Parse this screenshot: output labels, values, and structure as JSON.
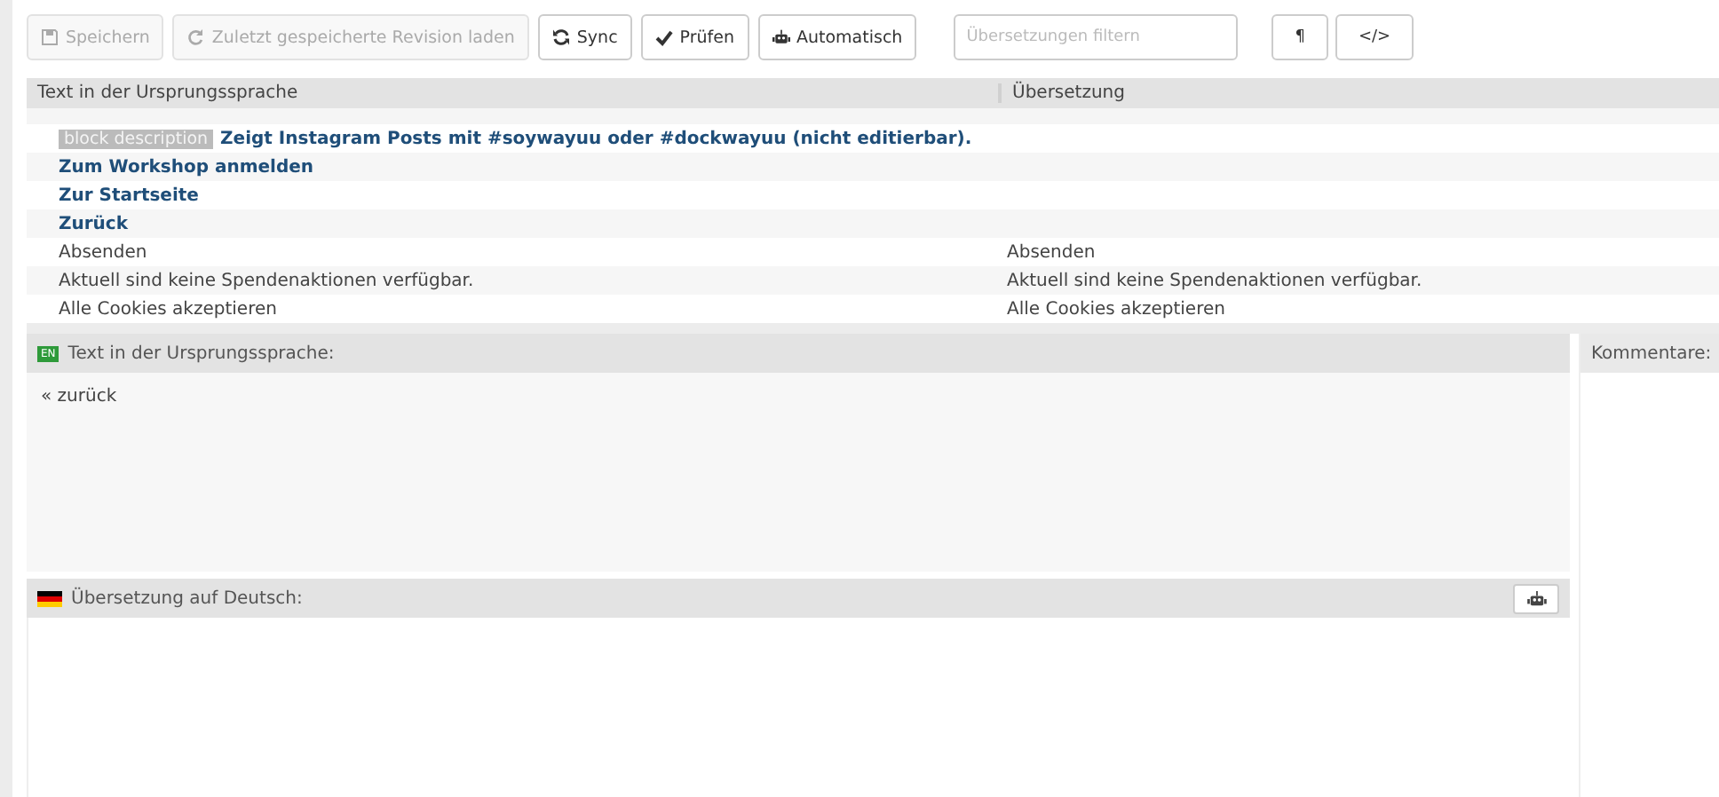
{
  "toolbar": {
    "buttons": [
      {
        "label": "Speichern",
        "disabled": true
      },
      {
        "label": "Zuletzt gespeicherte Revision laden",
        "disabled": true
      },
      {
        "label": "Sync",
        "disabled": false
      },
      {
        "label": "Prüfen",
        "disabled": false
      },
      {
        "label": "Automatisch",
        "disabled": false
      }
    ],
    "filter": {
      "placeholder": "Übersetzungen filtern"
    },
    "format_buttons": [
      "¶",
      "</>"
    ]
  },
  "table": {
    "columns": [
      "Text in der Ursprungssprache",
      "Übersetzung"
    ],
    "rows": [
      {
        "kind": "heading",
        "tag": "block description",
        "source": "Zeigt Instagram Posts mit #soywayuu oder #dockwayuu (nicht editierbar).",
        "translation": null
      },
      {
        "kind": "heading",
        "source": "Zum Workshop anmelden",
        "translation": null
      },
      {
        "kind": "heading",
        "source": "Zur Startseite",
        "translation": null
      },
      {
        "kind": "heading",
        "source": "Zurück",
        "translation": null
      },
      {
        "kind": "plain",
        "source": "Absenden",
        "translation": "Absenden"
      },
      {
        "kind": "plain",
        "source": "Aktuell sind keine Spendenaktionen verfügbar.",
        "translation": "Aktuell sind keine Spendenaktionen verfügbar."
      },
      {
        "kind": "plain",
        "source": "Alle Cookies akzeptieren",
        "translation": "Alle Cookies akzeptieren"
      }
    ]
  },
  "source_panel": {
    "badge": "EN",
    "title": "Text in der Ursprungssprache:",
    "text": "« zurück"
  },
  "translation_panel": {
    "title": "Übersetzung auf Deutsch:"
  },
  "comments": {
    "title": "Kommentare:"
  }
}
